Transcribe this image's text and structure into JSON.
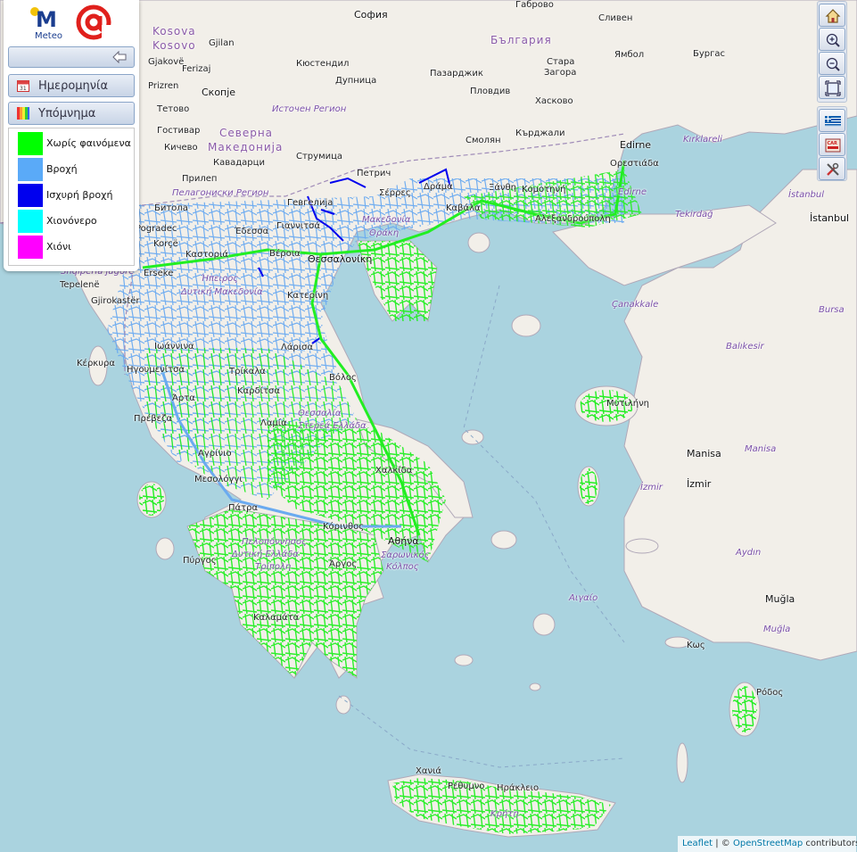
{
  "panel": {
    "logo_text": "Meteo",
    "date_label": "Ημερομηνία",
    "legend_label": "Υπόμνημα",
    "legend_items": [
      {
        "label": "Χωρίς φαινόμενα",
        "color": "#00ff00"
      },
      {
        "label": "Βροχή",
        "color": "#5aaaf8"
      },
      {
        "label": "Ισχυρή βροχή",
        "color": "#0000ee"
      },
      {
        "label": "Χιονόνερο",
        "color": "#00ffff"
      },
      {
        "label": "Χιόνι",
        "color": "#ff00ff"
      }
    ]
  },
  "toolbar": {
    "buttons": [
      "home-icon",
      "zoom-in-icon",
      "zoom-out-icon",
      "fit-extent-icon",
      "greek-flag-icon",
      "car-route-icon",
      "tools-icon"
    ]
  },
  "attribution": {
    "leaflet": "Leaflet",
    "separator": " | © ",
    "osm": "OpenStreetMap",
    "suffix": " contributors"
  },
  "places": {
    "sofia": "София",
    "bulgaria": "България",
    "kosova": "Kosova",
    "kosovo": "Kosovo",
    "gjilan": "Gjilan",
    "gjakove": "Gjakovë",
    "ferizaj": "Ferizaj",
    "prizren": "Prizren",
    "kyustendil": "Кюстендил",
    "dupnitsa": "Дупница",
    "pazardzhik": "Пазарджик",
    "plovdiv": "Пловдив",
    "stara_zagora_1": "Стара",
    "stara_zagora_2": "Загора",
    "sliven": "Сливен",
    "yambol": "Ямбол",
    "burgas": "Бургас",
    "gabrovo": "Габрово",
    "skopje": "Скопје",
    "istochen_region": "Источен Регион",
    "haskovo": "Хасково",
    "kardzhali": "Кърджали",
    "smolyan": "Смолян",
    "tetovo": "Тетово",
    "gostivar": "Гостивар",
    "kichevo": "Кичево",
    "severna_1": "Северна",
    "severna_2": "Македонија",
    "kavadarci": "Кавадарци",
    "prilep": "Прилеп",
    "strumica": "Струмица",
    "pelagoniski": "Пелагониски Регион",
    "bitola": "Битола",
    "korce": "Korçë",
    "pogradec": "Pogradec",
    "erseke": "Erseke",
    "shqiperia": "Shqipëria jugore",
    "tepelene": "Tepelenë",
    "gjirokaster": "Gjirokastër",
    "edirne": "Edirne",
    "edirne_province": "Edirne",
    "kirklareli": "Kırklareli",
    "orestiada": "Ορεστιάδα",
    "tekirdag": "Tekirdağ",
    "istanbul_province": "İstanbul",
    "istanbul": "İstanbul",
    "canakkale": "Çanakkale",
    "bursa": "Bursa",
    "balikesir": "Balıkesir",
    "manisa_region": "Manisa",
    "manisa": "Manisa",
    "izmir_region": "İzmir",
    "izmir": "İzmir",
    "aydin": "Aydın",
    "mugla": "Muğla",
    "mugla_region": "Muğla",
    "kos": "Κως",
    "rodos": "Ρόδος",
    "thessaloniki": "Θεσσαλονίκη",
    "makedonia_thraki_1": "Μακεδονία",
    "makedonia_thraki_2": "Θράκη",
    "drama": "Δράμα",
    "serres": "Σέρρες",
    "kavala": "Καβάλα",
    "xanthi": "Ξάνθη",
    "komotini": "Κομοτηνή",
    "alexandroupoli": "Αλεξανδρούπολη",
    "petrich": "Петрич",
    "gevgelija": "Гевгелија",
    "giannitsa": "Γιαννιτσά",
    "edessa": "Έδεσσα",
    "veroia": "Βέροια",
    "kastoria": "Καστοριά",
    "katerini": "Κατερίνη",
    "ipeiros": "Ήπειρος",
    "dytiki_makedonia": "Δυτική Μακεδονία",
    "ioannina": "Ιωάννινα",
    "kerkyra": "Κέρκυρα",
    "igoumenitsa": "Ηγουμενίτσα",
    "arta": "Άρτα",
    "preveza": "Πρέβεζα",
    "trikala": "Τρίκαλα",
    "larisa": "Λάρισα",
    "karditsa": "Καρδίτσα",
    "volos": "Βόλος",
    "thessalia": "Θεσσαλία",
    "sterea": "Στερεά Ελλάδα",
    "lamia": "Λαμία",
    "agrinio": "Αγρίνιο",
    "mesolongi": "Μεσολόγγι",
    "chalkida": "Χαλκίδα",
    "patra": "Πάτρα",
    "korinthos": "Κόρινθος",
    "athina": "Αθήνα",
    "saronikos_1": "Σαρωνικός",
    "saronikos_2": "Κόλπος",
    "peloponnisos": "Πελοπόννησος",
    "dytiki_ellada": "Δυτική Ελλάδα",
    "pyrgos": "Πύργος",
    "tripoli": "Τρίπολη",
    "argos": "Άργος",
    "kalamata": "Καλαμάτα",
    "mytilini": "Μυτιλήνη",
    "aigaio": "Αιγαίο",
    "chania": "Χανιά",
    "rethymno": "Ρέθυμνο",
    "irakleio": "Ηράκλειο",
    "kriti": "Κρήτη"
  }
}
